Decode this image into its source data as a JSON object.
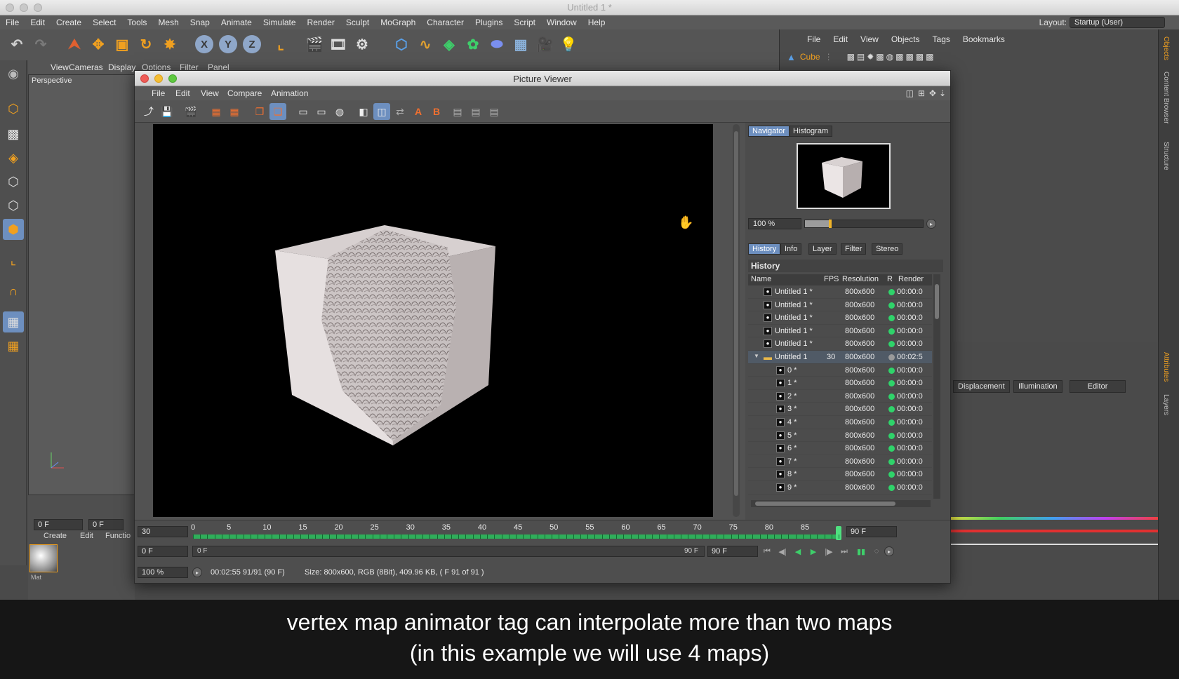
{
  "app": {
    "window_title": "Untitled 1 *"
  },
  "main_menu": [
    "File",
    "Edit",
    "Create",
    "Select",
    "Tools",
    "Mesh",
    "Snap",
    "Animate",
    "Simulate",
    "Render",
    "Sculpt",
    "MoGraph",
    "Character",
    "Plugins",
    "Script",
    "Window",
    "Help"
  ],
  "layout": {
    "label": "Layout:",
    "value": "Startup (User)"
  },
  "object_manager": {
    "menu": [
      "File",
      "Edit",
      "View",
      "Objects",
      "Tags",
      "Bookmarks"
    ],
    "object_name": "Cube"
  },
  "right_tabs": [
    "Objects",
    "Content Browser",
    "Structure",
    "Attributes",
    "Layers"
  ],
  "viewport": {
    "menu": [
      "View",
      "Cameras",
      "Display",
      "Options",
      "Filter",
      "Panel"
    ],
    "label": "Perspective"
  },
  "attributes": {
    "tabs": [
      "Displacement",
      "Illumination",
      "Editor"
    ]
  },
  "bottom_left": {
    "menu": [
      "Create",
      "Edit",
      "Functio"
    ],
    "frame_field": "0 F",
    "frame_field2": "0 F",
    "material_label": "Mat"
  },
  "picture_viewer": {
    "title": "Picture Viewer",
    "menu": [
      "File",
      "Edit",
      "View",
      "Compare",
      "Animation"
    ],
    "nav_tabs": [
      "Navigator",
      "Histogram"
    ],
    "zoom": "100 %",
    "zoom_level": 0.2,
    "info_tabs": [
      "History",
      "Info",
      "Layer",
      "Filter",
      "Stereo"
    ],
    "history_heading": "History",
    "columns": {
      "name": "Name",
      "fps": "FPS",
      "resolution": "Resolution",
      "r": "R",
      "render": "Render"
    },
    "rows": [
      {
        "name": "Untitled 1 *",
        "fps": "",
        "res": "800x600",
        "status": "green",
        "render": "00:00:0",
        "indent": 0,
        "icon": "image"
      },
      {
        "name": "Untitled 1 *",
        "fps": "",
        "res": "800x600",
        "status": "green",
        "render": "00:00:0",
        "indent": 0,
        "icon": "image"
      },
      {
        "name": "Untitled 1 *",
        "fps": "",
        "res": "800x600",
        "status": "green",
        "render": "00:00:0",
        "indent": 0,
        "icon": "image"
      },
      {
        "name": "Untitled 1 *",
        "fps": "",
        "res": "800x600",
        "status": "green",
        "render": "00:00:0",
        "indent": 0,
        "icon": "image"
      },
      {
        "name": "Untitled 1 *",
        "fps": "",
        "res": "800x600",
        "status": "green",
        "render": "00:00:0",
        "indent": 0,
        "icon": "image"
      },
      {
        "name": "Untitled 1",
        "fps": "30",
        "res": "800x600",
        "status": "gray",
        "render": "00:02:5",
        "indent": 0,
        "icon": "folder"
      },
      {
        "name": "0 *",
        "fps": "",
        "res": "800x600",
        "status": "green",
        "render": "00:00:0",
        "indent": 1,
        "icon": "image"
      },
      {
        "name": "1 *",
        "fps": "",
        "res": "800x600",
        "status": "green",
        "render": "00:00:0",
        "indent": 1,
        "icon": "image"
      },
      {
        "name": "2 *",
        "fps": "",
        "res": "800x600",
        "status": "green",
        "render": "00:00:0",
        "indent": 1,
        "icon": "image"
      },
      {
        "name": "3 *",
        "fps": "",
        "res": "800x600",
        "status": "green",
        "render": "00:00:0",
        "indent": 1,
        "icon": "image"
      },
      {
        "name": "4 *",
        "fps": "",
        "res": "800x600",
        "status": "green",
        "render": "00:00:0",
        "indent": 1,
        "icon": "image"
      },
      {
        "name": "5 *",
        "fps": "",
        "res": "800x600",
        "status": "green",
        "render": "00:00:0",
        "indent": 1,
        "icon": "image"
      },
      {
        "name": "6 *",
        "fps": "",
        "res": "800x600",
        "status": "green",
        "render": "00:00:0",
        "indent": 1,
        "icon": "image"
      },
      {
        "name": "7 *",
        "fps": "",
        "res": "800x600",
        "status": "green",
        "render": "00:00:0",
        "indent": 1,
        "icon": "image"
      },
      {
        "name": "8 *",
        "fps": "",
        "res": "800x600",
        "status": "green",
        "render": "00:00:0",
        "indent": 1,
        "icon": "image"
      },
      {
        "name": "9 *",
        "fps": "",
        "res": "800x600",
        "status": "green",
        "render": "00:00:0",
        "indent": 1,
        "icon": "image"
      }
    ],
    "timeline": {
      "fps_field": "30",
      "start_field": "0 F",
      "zoom_field": "100 %",
      "ticks": [
        "0",
        "5",
        "10",
        "15",
        "20",
        "25",
        "30",
        "35",
        "40",
        "45",
        "50",
        "55",
        "60",
        "65",
        "70",
        "75",
        "80",
        "85"
      ],
      "end_field": "90 F",
      "range_start": "0 F",
      "range_end": "90 F",
      "end_field2": "90 F",
      "current_frame": 90,
      "total_frames": 90,
      "status_time": "00:02:55 91/91 (90 F)",
      "status_size": "Size: 800x600, RGB (8Bit), 409.96 KB, ( F 91 of 91 )"
    }
  },
  "caption": {
    "line1": "vertex map animator tag can interpolate more than two maps",
    "line2": "(in this example we will use 4 maps)"
  },
  "colors": {
    "green": "#2fd36a",
    "gray": "#9a9a9a",
    "accent": "#6d8fbf"
  }
}
